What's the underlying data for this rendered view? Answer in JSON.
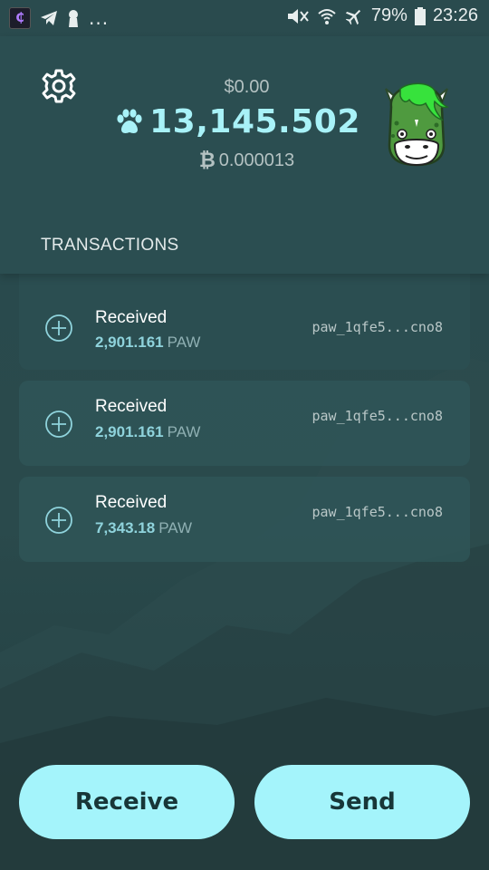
{
  "status_bar": {
    "battery": "79%",
    "time": "23:26",
    "overflow": "..."
  },
  "header": {
    "balance_fiat": "$0.00",
    "balance_main": "13,145.502",
    "btc_symbol": "₿",
    "balance_btc": "0.000013",
    "section_title": "TRANSACTIONS"
  },
  "transactions": [
    {
      "type": "Received",
      "amount": "2,901.161",
      "unit": "PAW",
      "address": "paw_1qfe5...cno8"
    },
    {
      "type": "Received",
      "amount": "2,901.161",
      "unit": "PAW",
      "address": "paw_1qfe5...cno8"
    },
    {
      "type": "Received",
      "amount": "7,343.18",
      "unit": "PAW",
      "address": "paw_1qfe5...cno8"
    }
  ],
  "actions": {
    "receive_label": "Receive",
    "send_label": "Send"
  },
  "colors": {
    "accent": "#a4f4fb",
    "balance": "#a8f2f8",
    "background": "#2a4b4e"
  },
  "icons": {
    "settings": "gear-icon",
    "paw": "paw-icon",
    "avatar": "horse-avatar-icon",
    "tx": "plus-circle-icon"
  }
}
